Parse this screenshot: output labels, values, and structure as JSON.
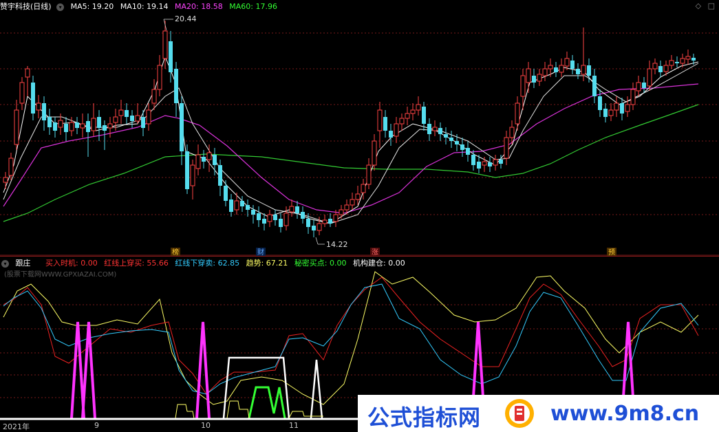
{
  "top_header": {
    "title": "赞宇科技(日线)",
    "ma5": "MA5: 19.20",
    "ma10": "MA10: 19.14",
    "ma20": "MA20: 18.58",
    "ma60": "MA60: 17.96",
    "colors": {
      "ma5": "#ffffff",
      "ma10": "#ffffff",
      "ma20": "#ff44ff",
      "ma60": "#33ff33"
    }
  },
  "top_chart": {
    "high_label": "20.44",
    "low_label": "14.22",
    "markers": [
      "榜",
      "财",
      "涨",
      "预"
    ],
    "grid_labels": []
  },
  "bottom_header": {
    "title": "跟庄",
    "buy_signal": "买入时机: 0.00",
    "red_up": "红线上穿买: 55.66",
    "red_down": "红线下穿卖: 62.85",
    "trend": "趋势: 67.21",
    "secret_buy": "秘密买点: 0.00",
    "inst_build": "机构建仓: 0.00",
    "colors": {
      "buy_signal": "#ff3333",
      "red_up": "#ff3333",
      "red_down": "#33ccff",
      "trend": "#ffff66",
      "secret_buy": "#33ff33",
      "inst_build": "#ffffff"
    }
  },
  "watermark": "(股票下载网WWW.GPXIAZAI.COM)",
  "x_axis": [
    "2021年",
    "9",
    "10",
    "11"
  ],
  "banner": {
    "text_left": "公式指标网",
    "text_right": "www.9m8.cn"
  },
  "icons": [
    "settings-icon",
    "diamond-icon",
    "square-icon"
  ]
}
